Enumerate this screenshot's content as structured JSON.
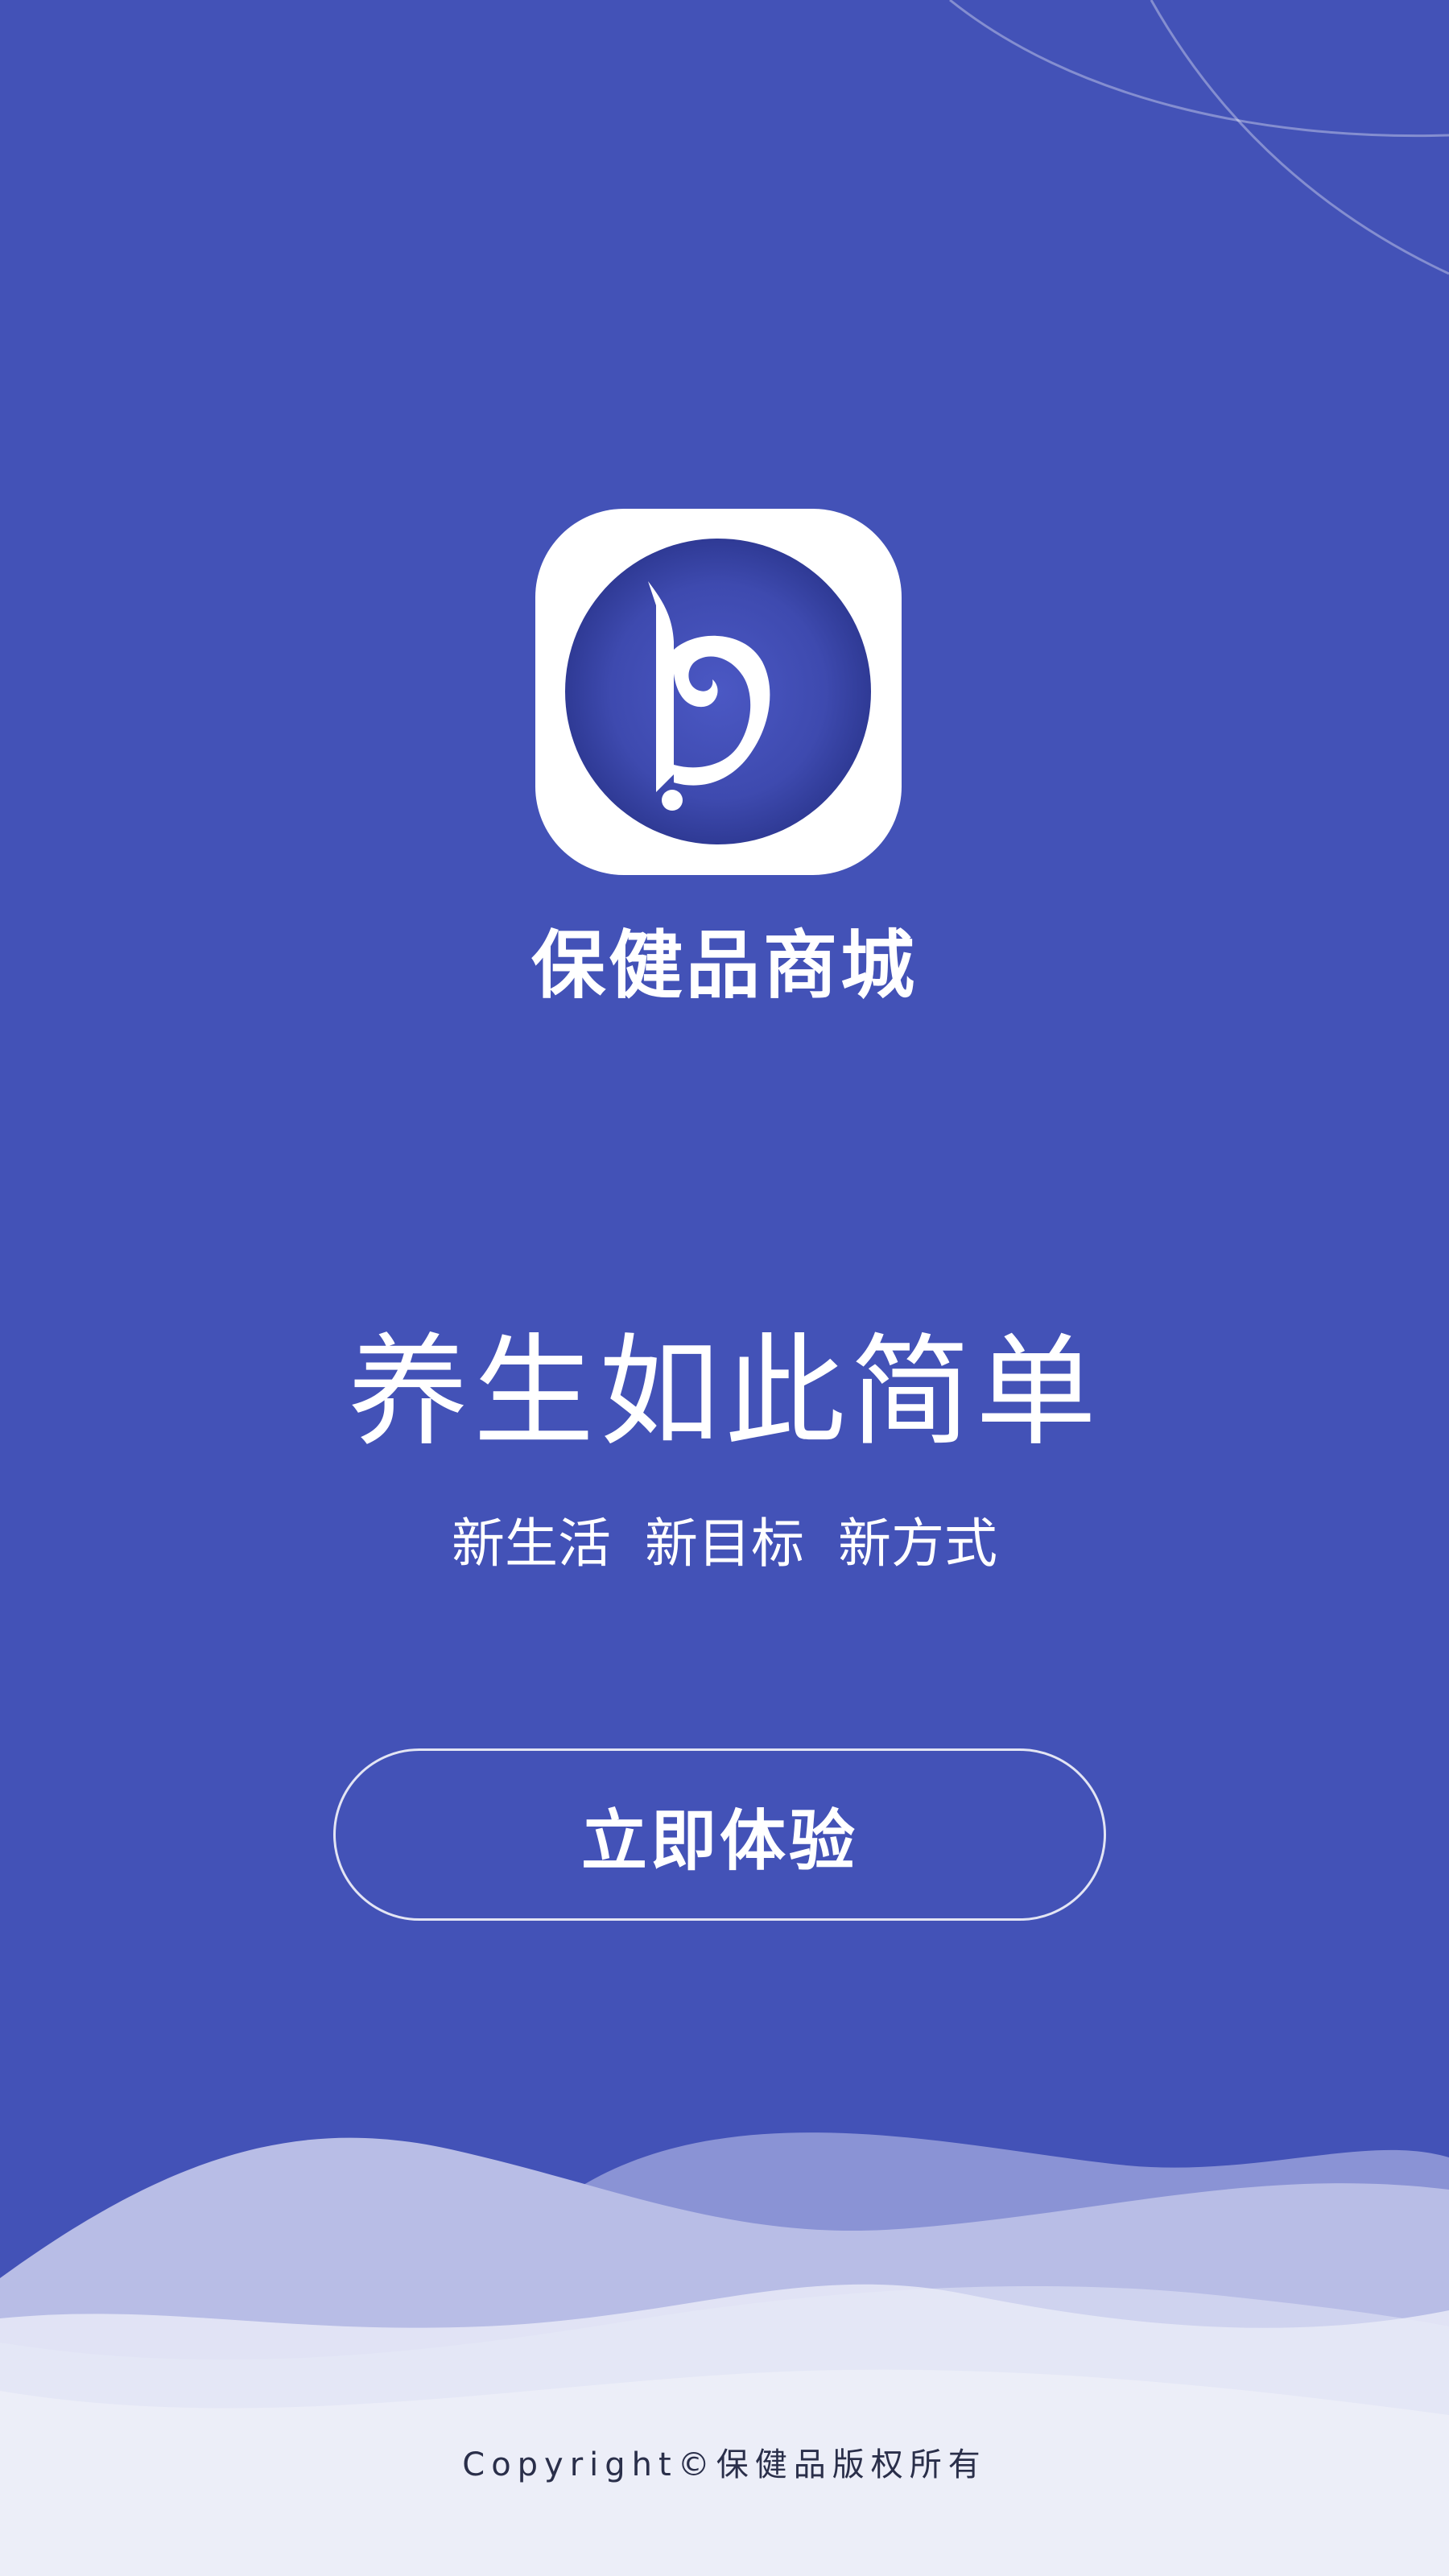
{
  "app": {
    "name": "保健品商城",
    "logo_icon": "brand-b-logo-icon"
  },
  "splash": {
    "slogan": "养生如此简单",
    "sub_slogan": "新生活  新目标  新方式",
    "cta_label": "立即体验"
  },
  "footer": {
    "copyright": "Copyright©保健品版权所有"
  },
  "colors": {
    "background": "#4352b7",
    "logo_circle": "#3f4bb0",
    "white": "#ffffff"
  }
}
